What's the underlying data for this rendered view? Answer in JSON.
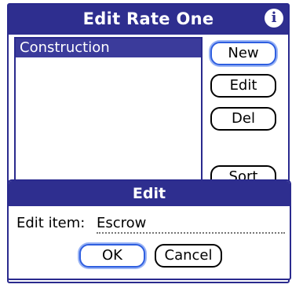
{
  "form": {
    "title": "Edit Rate One",
    "info_icon": "info-icon",
    "list_items": [
      "Construction"
    ],
    "buttons": {
      "new": "New",
      "edit": "Edit",
      "del": "Del",
      "sort": "Sort"
    }
  },
  "dialog": {
    "title": "Edit",
    "field_label": "Edit item:",
    "field_value": "Escrow",
    "ok": "OK",
    "cancel": "Cancel"
  },
  "colors": {
    "titlebar": "#2e2e8f",
    "selection": "#3b3b9b",
    "focus_ring": "#2f5fe0"
  }
}
